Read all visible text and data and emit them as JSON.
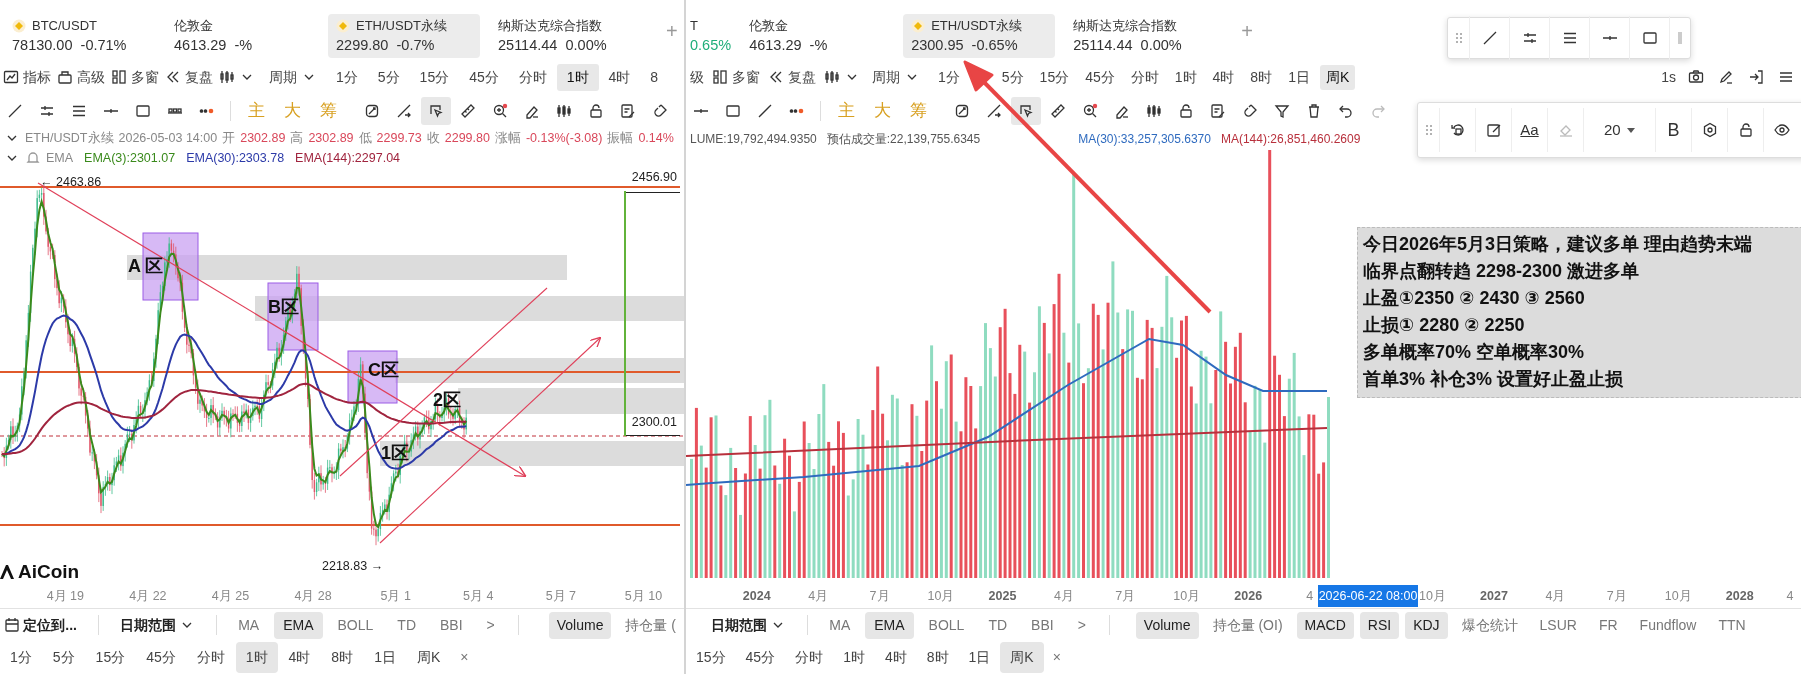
{
  "left_panel": {
    "tickers": [
      {
        "kind": "coin",
        "symbol": "BTC/USDT",
        "price": "78130.00",
        "change": "-0.71%",
        "selected": false
      },
      {
        "kind": "plain",
        "symbol": "伦敦金",
        "price": "4613.29",
        "change": "-%",
        "selected": false
      },
      {
        "kind": "coin",
        "symbol": "ETH/USDT永续",
        "price": "2299.80",
        "change": "-0.7%",
        "selected": true
      },
      {
        "kind": "plain",
        "symbol": "纳斯达克综合指数",
        "price": "25114.44",
        "change": "0.00%",
        "selected": false
      }
    ],
    "add_tab": "+",
    "menus": [
      {
        "kind": "indicator",
        "label": "指标"
      },
      {
        "kind": "advanced",
        "label": "高级"
      },
      {
        "kind": "window",
        "label": "多窗"
      },
      {
        "kind": "replay",
        "label": "复盘"
      },
      {
        "kind": "charttype"
      },
      {
        "kind": "period",
        "label": "周期"
      }
    ],
    "intervals": [
      {
        "label": "1分",
        "selected": false
      },
      {
        "label": "5分",
        "selected": false
      },
      {
        "label": "15分",
        "selected": false
      },
      {
        "label": "45分",
        "selected": false
      },
      {
        "label": "分时",
        "selected": false
      },
      {
        "label": "1时",
        "selected": true
      },
      {
        "label": "4时",
        "selected": false
      },
      {
        "label": "8",
        "selected": false
      }
    ],
    "draw_tools": [
      {
        "kind": "line"
      },
      {
        "kind": "channel"
      },
      {
        "kind": "lines"
      },
      {
        "kind": "segment"
      },
      {
        "kind": "rect"
      },
      {
        "kind": "beads"
      },
      {
        "kind": "dots"
      }
    ],
    "quick_labels": [
      "主",
      "大",
      "筹"
    ],
    "tools": [
      {
        "kind": "rotate",
        "selected": false
      },
      {
        "kind": "measure",
        "selected": false
      },
      {
        "kind": "select",
        "selected": true
      },
      {
        "kind": "ruler",
        "selected": false
      },
      {
        "kind": "zoom",
        "selected": false
      },
      {
        "kind": "eraser",
        "selected": false
      },
      {
        "kind": "candles",
        "selected": false
      },
      {
        "kind": "lock",
        "selected": false
      },
      {
        "kind": "note",
        "selected": false
      },
      {
        "kind": "magnet",
        "selected": false
      }
    ],
    "info": {
      "symbol": "ETH/USDT永续",
      "time": "2026-05-03 14:00",
      "fields": [
        {
          "label": "开",
          "value": "2302.89"
        },
        {
          "label": "高",
          "value": "2302.89"
        },
        {
          "label": "低",
          "value": "2299.73"
        },
        {
          "label": "收",
          "value": "2299.80"
        },
        {
          "label": "涨幅",
          "value": "-0.13%(-3.08)"
        },
        {
          "label": "振幅",
          "value": "0.14%"
        }
      ]
    },
    "indicator": {
      "name": "EMA",
      "lines": [
        {
          "label": "EMA(3):2301.07",
          "color": "#3a8a1c"
        },
        {
          "label": "EMA(30):2303.78",
          "color": "#2c3aa8"
        },
        {
          "label": "EMA(144):2297.04",
          "color": "#a0243e"
        }
      ]
    },
    "chart": {
      "price_labels": [
        {
          "kind": "high",
          "text": "← 2463.86"
        },
        {
          "kind": "axis",
          "text": "2456.90"
        },
        {
          "kind": "axis",
          "text": "2300.01"
        },
        {
          "kind": "low",
          "text": "2218.83 →"
        }
      ],
      "zones": [
        {
          "label": "A 区"
        },
        {
          "label": "B区"
        },
        {
          "label": "C区"
        },
        {
          "label": "2区"
        },
        {
          "label": "1区"
        }
      ],
      "logo": "AiCoin",
      "x_labels": [
        "4月 19",
        "4月 22",
        "4月 25",
        "4月 28",
        "5月 1",
        "5月 4",
        "5月 7",
        "5月 10"
      ]
    },
    "bottom": {
      "locate": "定位到...",
      "date_range": "日期范围",
      "indicators": [
        {
          "label": "MA",
          "selected": false
        },
        {
          "label": "EMA",
          "selected": true
        },
        {
          "label": "BOLL",
          "selected": false
        },
        {
          "label": "TD",
          "selected": false
        },
        {
          "label": "BBI",
          "selected": false
        }
      ],
      "more": ">",
      "sub_indicators": [
        {
          "label": "Volume",
          "selected": true
        },
        {
          "label": "持仓量 (",
          "selected": false
        }
      ],
      "intervals": [
        {
          "label": "1分",
          "selected": false
        },
        {
          "label": "5分",
          "selected": false
        },
        {
          "label": "15分",
          "selected": false
        },
        {
          "label": "45分",
          "selected": false
        },
        {
          "label": "分时",
          "selected": false
        },
        {
          "label": "1时",
          "selected": true
        },
        {
          "label": "4时",
          "selected": false
        },
        {
          "label": "8时",
          "selected": false
        },
        {
          "label": "1日",
          "selected": false
        },
        {
          "label": "周K",
          "selected": false
        }
      ],
      "close": "×"
    }
  },
  "right_panel": {
    "tickers": [
      {
        "kind": "cut",
        "symbol": "T",
        "change": "0.65%",
        "color": "#1fae7a",
        "selected": false
      },
      {
        "kind": "plain",
        "symbol": "伦敦金",
        "price": "4613.29",
        "change": "-%",
        "selected": false
      },
      {
        "kind": "coin",
        "symbol": "ETH/USDT永续",
        "price": "2300.95",
        "change": "-0.65%",
        "selected": true
      },
      {
        "kind": "plain",
        "symbol": "纳斯达克综合指数",
        "price": "25114.44",
        "change": "0.00%",
        "selected": false
      }
    ],
    "add_tab": "+",
    "menus": [
      {
        "kind": "text",
        "label": "级"
      },
      {
        "kind": "window",
        "label": "多窗"
      },
      {
        "kind": "replay",
        "label": "复盘"
      },
      {
        "kind": "charttype"
      },
      {
        "kind": "period",
        "label": "周期"
      }
    ],
    "intervals": [
      {
        "label": "1分",
        "selected": false
      },
      {
        "label": "5分",
        "selected": false
      },
      {
        "label": "15分",
        "selected": false
      },
      {
        "label": "45分",
        "selected": false
      },
      {
        "label": "分时",
        "selected": false
      },
      {
        "label": "1时",
        "selected": false
      },
      {
        "label": "4时",
        "selected": false
      },
      {
        "label": "8时",
        "selected": false
      },
      {
        "label": "1日",
        "selected": false
      },
      {
        "label": "周K",
        "selected": true
      }
    ],
    "refresh": "1s",
    "draw_tools": [
      {
        "kind": "segment"
      },
      {
        "kind": "rect"
      },
      {
        "kind": "line"
      },
      {
        "kind": "dots"
      }
    ],
    "quick_labels": [
      "主",
      "大",
      "筹"
    ],
    "tools": [
      {
        "kind": "rotate",
        "selected": false,
        "disabled": false
      },
      {
        "kind": "measure",
        "selected": false,
        "disabled": false
      },
      {
        "kind": "select",
        "selected": true,
        "disabled": false
      },
      {
        "kind": "ruler",
        "selected": false,
        "disabled": false
      },
      {
        "kind": "zoom",
        "selected": false,
        "disabled": false
      },
      {
        "kind": "eraser",
        "selected": false,
        "disabled": false
      },
      {
        "kind": "candles",
        "selected": false,
        "disabled": false
      },
      {
        "kind": "lock",
        "selected": false,
        "disabled": false
      },
      {
        "kind": "note",
        "selected": false,
        "disabled": false
      },
      {
        "kind": "magnet",
        "selected": false,
        "disabled": false
      },
      {
        "kind": "filter",
        "selected": false,
        "disabled": false
      },
      {
        "kind": "trash",
        "selected": false,
        "disabled": false
      },
      {
        "kind": "undo",
        "selected": false,
        "disabled": false
      },
      {
        "kind": "redo",
        "selected": false,
        "disabled": true
      }
    ],
    "text_toolbar": {
      "font_label": "Aa",
      "font_size": "20",
      "bold": "B"
    },
    "volume_info": [
      "LUME:19,792,494.9350",
      "预估成交量:22,139,755.6345"
    ],
    "ma_lines": [
      {
        "label": "MA(30):33,257,305.6370",
        "color": "#2f6bbf"
      },
      {
        "label": "MA(144):26,851,460.2609",
        "color": "#b8303c"
      }
    ],
    "note": [
      "今日2026年5月3日策略，建议多单 理由趋势末端",
      "临界点翻转趋 2298-2300 激进多单",
      "止盈①2350 ② 2430 ③ 2560",
      "止损① 2280 ② 2250",
      "多单概率70% 空单概率30%",
      "首单3% 补仓3% 设置好止盈止损"
    ],
    "x_labels": [
      {
        "kind": "year",
        "text": "2024"
      },
      {
        "kind": "month",
        "text": "4月"
      },
      {
        "kind": "month",
        "text": "7月"
      },
      {
        "kind": "month",
        "text": "10月"
      },
      {
        "kind": "year",
        "text": "2025"
      },
      {
        "kind": "month",
        "text": "4月"
      },
      {
        "kind": "month",
        "text": "7月"
      },
      {
        "kind": "month",
        "text": "10月"
      },
      {
        "kind": "year",
        "text": "2026"
      },
      {
        "kind": "month",
        "text": "4"
      },
      {
        "kind": "month",
        "text": "10月"
      },
      {
        "kind": "year",
        "text": "2027"
      },
      {
        "kind": "month",
        "text": "4月"
      },
      {
        "kind": "month",
        "text": "7月"
      },
      {
        "kind": "month",
        "text": "10月"
      },
      {
        "kind": "year",
        "text": "2028"
      },
      {
        "kind": "month",
        "text": "4"
      }
    ],
    "cursor_label": "2026-06-22 08:00",
    "bottom": {
      "date_range": "日期范围",
      "indicators": [
        {
          "label": "MA",
          "selected": false
        },
        {
          "label": "EMA",
          "selected": true
        },
        {
          "label": "BOLL",
          "selected": false
        },
        {
          "label": "TD",
          "selected": false
        },
        {
          "label": "BBI",
          "selected": false
        }
      ],
      "more": ">",
      "sub_indicators": [
        {
          "label": "Volume",
          "selected": true
        },
        {
          "label": "持仓量 (OI)",
          "selected": false
        },
        {
          "label": "MACD",
          "selected": true
        },
        {
          "label": "RSI",
          "selected": true
        },
        {
          "label": "KDJ",
          "selected": true
        },
        {
          "label": "爆仓统计",
          "selected": false
        },
        {
          "label": "LSUR",
          "selected": false
        },
        {
          "label": "FR",
          "selected": false
        },
        {
          "label": "Fundflow",
          "selected": false
        },
        {
          "label": "TTN",
          "selected": false
        }
      ],
      "intervals": [
        {
          "label": "15分",
          "selected": false
        },
        {
          "label": "45分",
          "selected": false
        },
        {
          "label": "分时",
          "selected": false
        },
        {
          "label": "1时",
          "selected": false
        },
        {
          "label": "4时",
          "selected": false
        },
        {
          "label": "8时",
          "selected": false
        },
        {
          "label": "1日",
          "selected": false
        },
        {
          "label": "周K",
          "selected": true
        }
      ],
      "close": "×"
    }
  }
}
